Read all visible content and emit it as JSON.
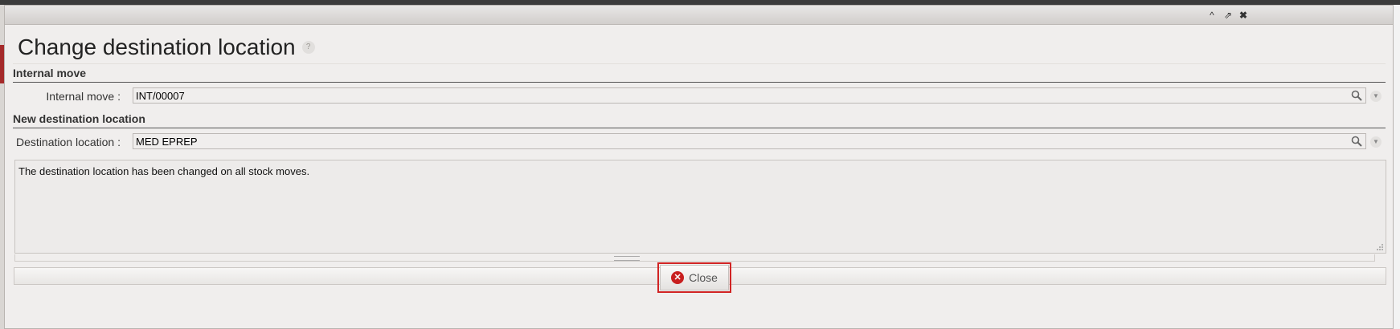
{
  "dialog": {
    "title": "Change destination location",
    "help_icon": "?",
    "titlebar_buttons": {
      "minimize": "^",
      "popout": "⇗",
      "close": "✖"
    }
  },
  "sections": {
    "internal_move": {
      "title": "Internal move",
      "field_label": "Internal move :",
      "field_value": "INT/00007"
    },
    "new_destination": {
      "title": "New destination location",
      "field_label": "Destination location :",
      "field_value": "MED EPREP"
    }
  },
  "message": "The destination location has been changed on all stock moves.",
  "buttons": {
    "close_label": "Close",
    "close_icon": "✕"
  },
  "icons": {
    "search": "search-icon",
    "dropdown": "chevron-down-icon"
  },
  "colors": {
    "close_outline": "#d12424",
    "close_icon_bg": "#c81f1f"
  }
}
